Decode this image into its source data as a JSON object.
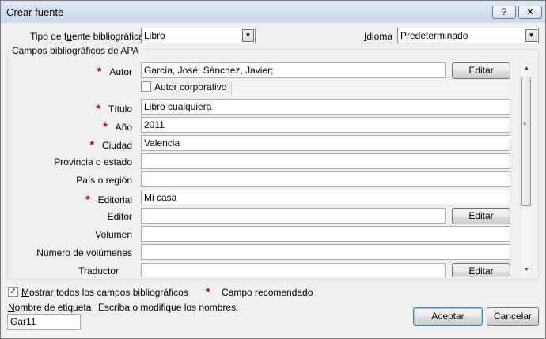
{
  "window": {
    "title": "Crear fuente",
    "help_label": "?",
    "close_label": "✕"
  },
  "source_type": {
    "label": "Tipo de fuente bibliográfica",
    "value": "Libro"
  },
  "language": {
    "label": "Idioma",
    "value": "Predeterminado"
  },
  "group_title": "Campos bibliográficos de APA",
  "fields": {
    "author": {
      "label": "Autor",
      "value": "García, José; Sánchez, Javier;",
      "button": "Editar"
    },
    "corporate": {
      "label": "Autor corporativo",
      "checked": false,
      "value": ""
    },
    "title": {
      "label": "Título",
      "value": "Libro cualquiera"
    },
    "year": {
      "label": "Año",
      "value": "2011"
    },
    "city": {
      "label": "Ciudad",
      "value": "Valencia"
    },
    "state": {
      "label": "Provincia o estado",
      "value": ""
    },
    "country": {
      "label": "País o región",
      "value": ""
    },
    "publisher": {
      "label": "Editorial",
      "value": "Mi casa"
    },
    "editor": {
      "label": "Editor",
      "value": "",
      "button": "Editar"
    },
    "volume": {
      "label": "Volumen",
      "value": ""
    },
    "num_volumes": {
      "label": "Número de volúmenes",
      "value": ""
    },
    "translator": {
      "label": "Traductor",
      "value": "",
      "button": "Editar"
    }
  },
  "required_marker": "*",
  "show_all": {
    "label": "Mostrar todos los campos bibliográficos",
    "checked": true
  },
  "recommended": {
    "marker": "*",
    "label": "Campo recomendado"
  },
  "tag": {
    "label": "Nombre de etiqueta",
    "hint": "Escriba o modifique los nombres.",
    "value": "Gar11"
  },
  "buttons": {
    "ok": "Aceptar",
    "cancel": "Cancelar"
  },
  "colors": {
    "title_bar": "#c9d8ea",
    "required_star": "#b00000",
    "window_bg": "#f0f0f0"
  }
}
